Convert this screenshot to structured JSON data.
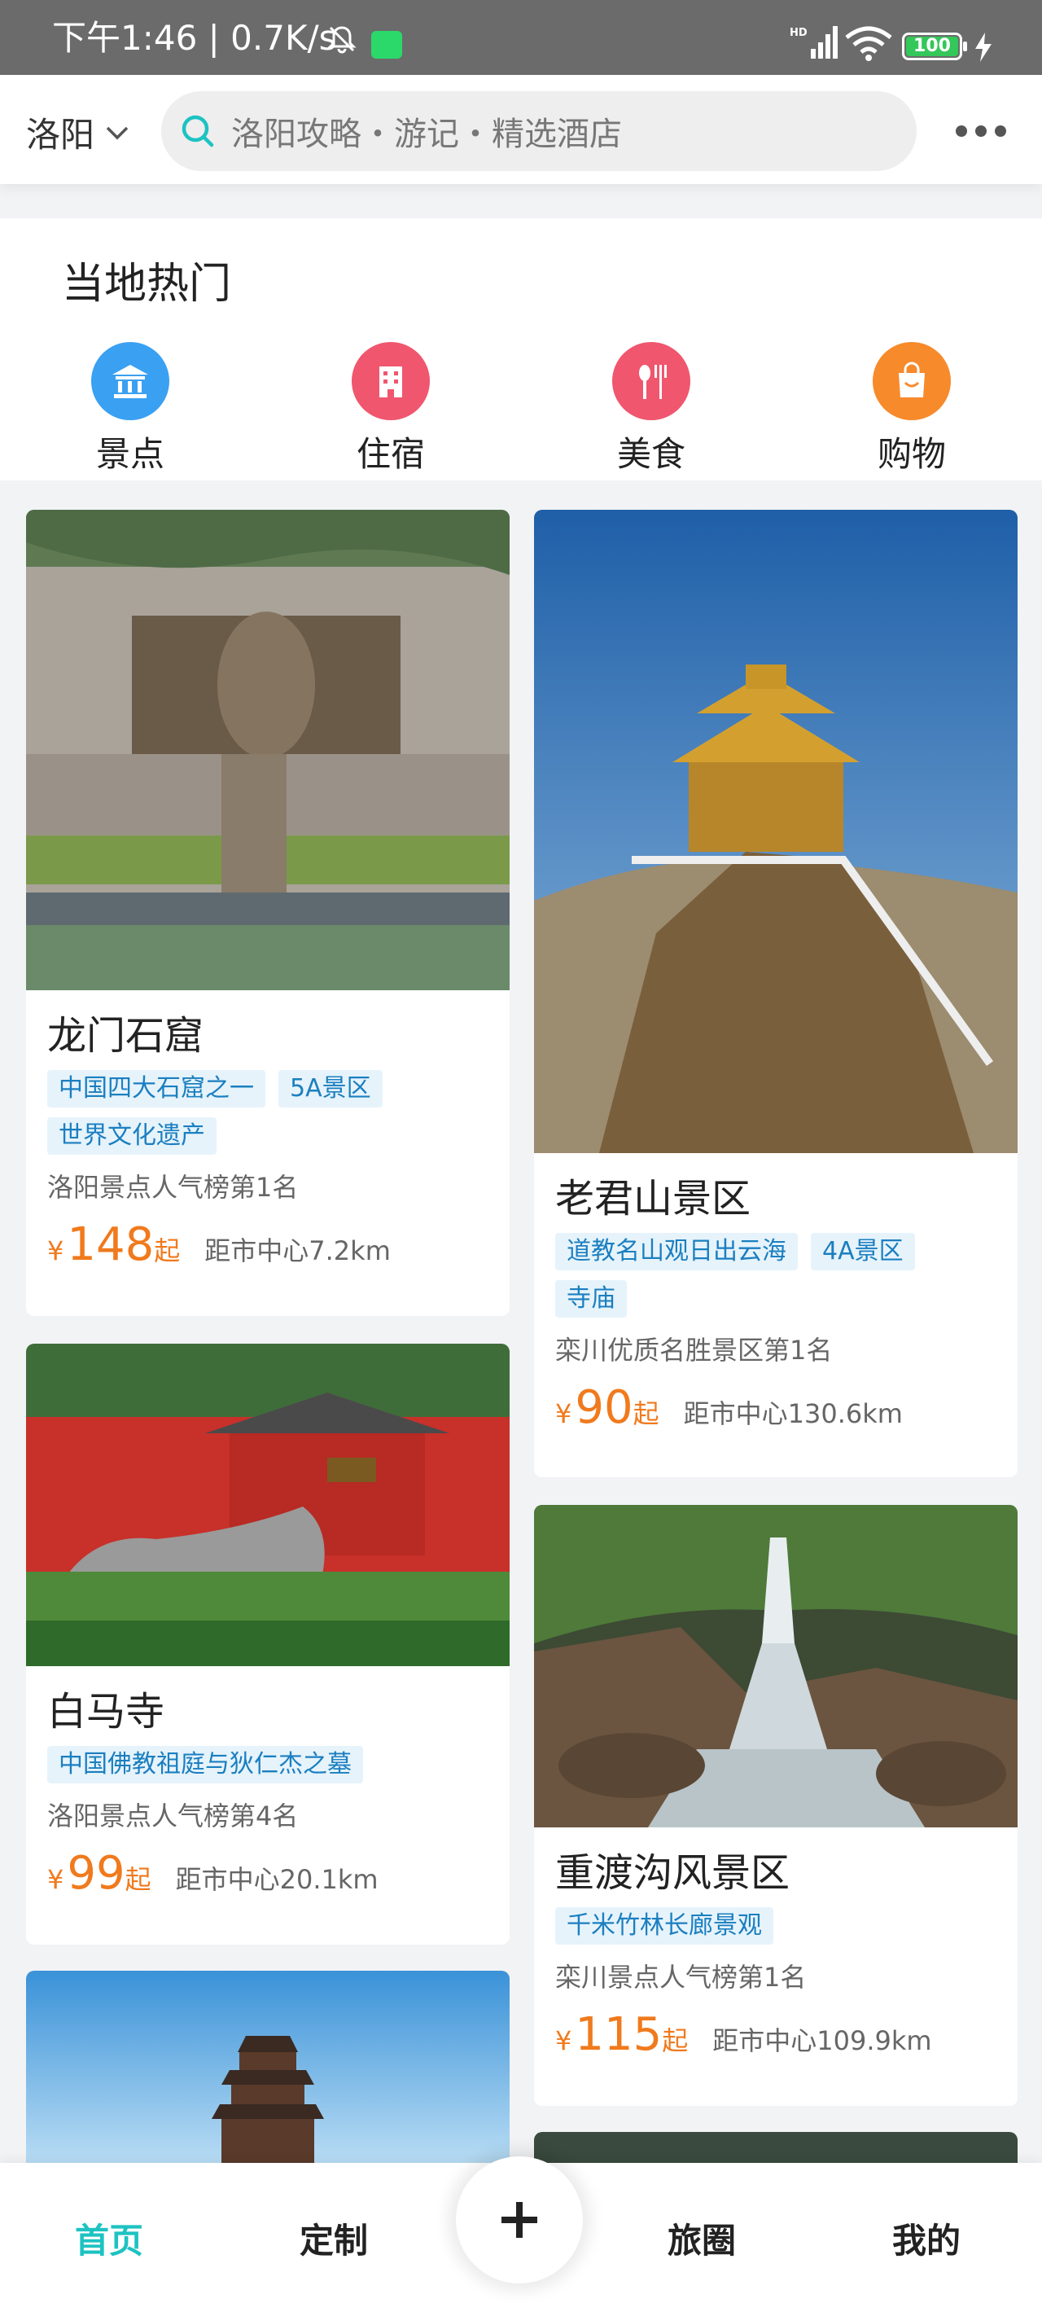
{
  "status_bar": {
    "time_speed": "下午1:46 | 0.7K/s",
    "battery": "100",
    "icons": [
      "bell-muted-icon",
      "wechat-icon",
      "hd-signal-icon",
      "wifi-icon",
      "battery-icon",
      "charging-icon"
    ]
  },
  "header": {
    "city": "洛阳",
    "search_placeholder": "洛阳攻略・游记・精选酒店",
    "icons": [
      "chevron-down-icon",
      "search-icon",
      "more-icon"
    ]
  },
  "hot": {
    "title": "当地热门",
    "categories": [
      {
        "label": "景点",
        "color": "#3aa0f2",
        "icon": "landmark-icon"
      },
      {
        "label": "住宿",
        "color": "#f0566e",
        "icon": "hotel-icon"
      },
      {
        "label": "美食",
        "color": "#f0566e",
        "icon": "food-icon"
      },
      {
        "label": "购物",
        "color": "#f78a2b",
        "icon": "shopping-bag-icon"
      }
    ]
  },
  "cards": {
    "longmen": {
      "name": "龙门石窟",
      "tags": [
        "中国四大石窟之一",
        "5A景区",
        "世界文化遗产"
      ],
      "rank": "洛阳景点人气榜第1名",
      "yen": "¥",
      "price": "148",
      "qi": "起",
      "dist": "距市中心7.2km"
    },
    "laojun": {
      "name": "老君山景区",
      "tags": [
        "道教名山观日出云海",
        "4A景区",
        "寺庙"
      ],
      "rank": "栾川优质名胜景区第1名",
      "yen": "¥",
      "price": "90",
      "qi": "起",
      "dist": "距市中心130.6km"
    },
    "baima": {
      "name": "白马寺",
      "tags": [
        "中国佛教祖庭与狄仁杰之墓"
      ],
      "rank": "洛阳景点人气榜第4名",
      "yen": "¥",
      "price": "99",
      "qi": "起",
      "dist": "距市中心20.1km"
    },
    "chongdu": {
      "name": "重渡沟风景区",
      "tags": [
        "千米竹林长廊景观"
      ],
      "rank": "栾川景点人气榜第1名",
      "yen": "¥",
      "price": "115",
      "qi": "起",
      "dist": "距市中心109.9km"
    }
  },
  "bottom_nav": {
    "home": "首页",
    "custom": "定制",
    "circle": "旅圈",
    "mine": "我的",
    "active_color": "#1ec2c2"
  }
}
